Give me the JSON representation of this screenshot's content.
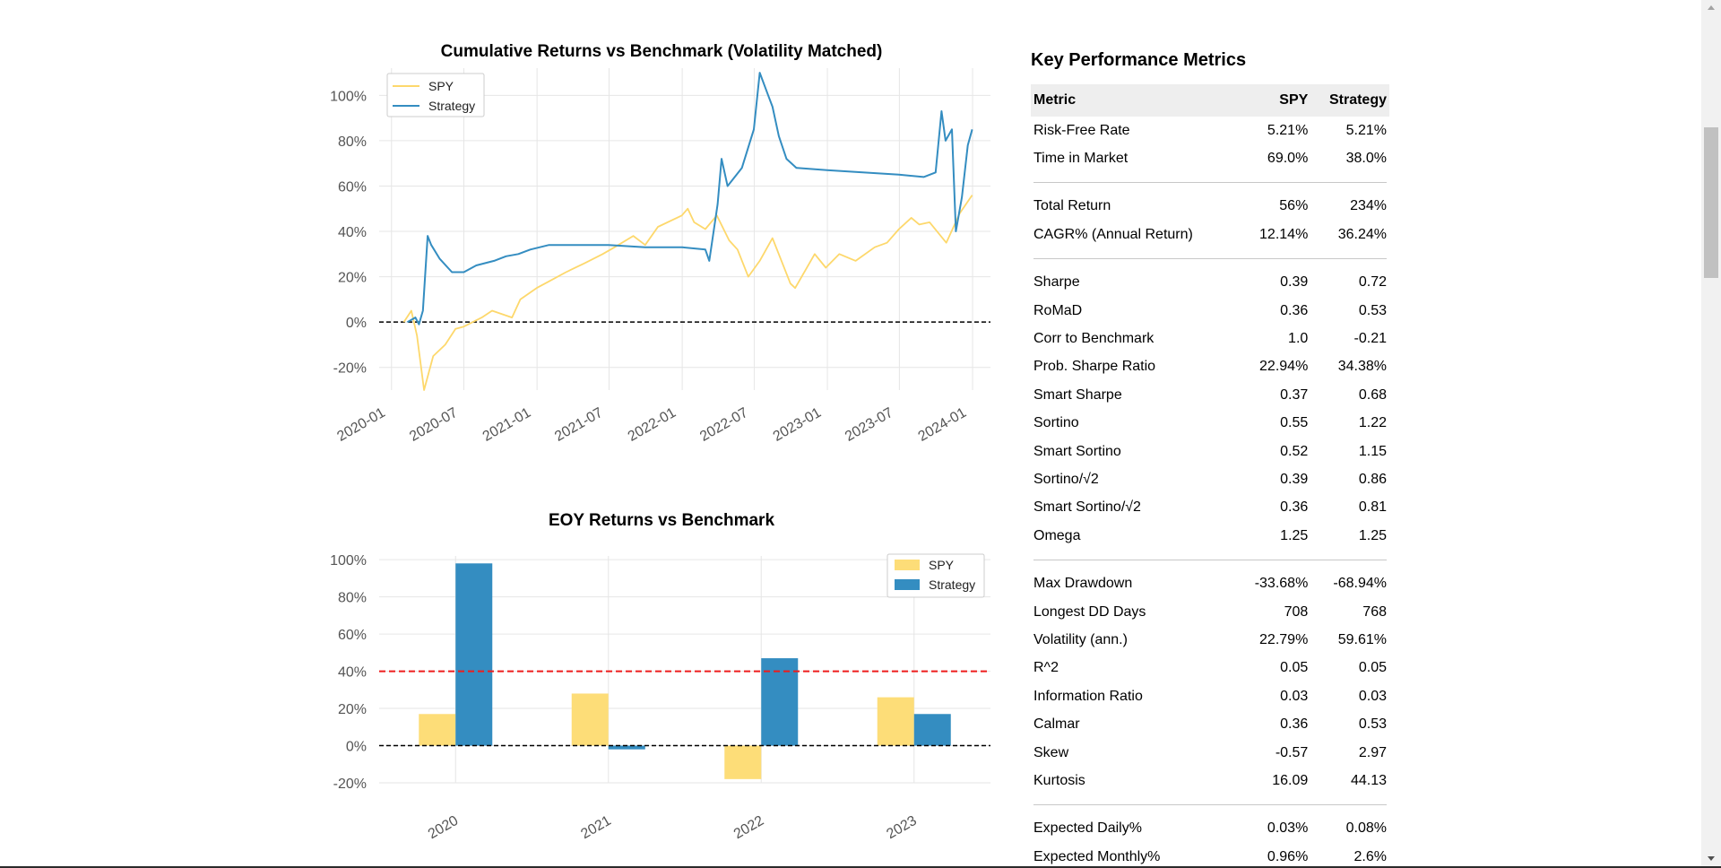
{
  "chart_data": [
    {
      "type": "line",
      "title": "Cumulative Returns vs Benchmark (Volatility Matched)",
      "x_ticks": [
        "2020-01",
        "2020-07",
        "2021-01",
        "2021-07",
        "2022-01",
        "2022-07",
        "2023-01",
        "2023-07",
        "2024-01"
      ],
      "y_ticks": [
        "-20%",
        "0%",
        "20%",
        "40%",
        "60%",
        "80%",
        "100%"
      ],
      "ylim": [
        -30,
        112
      ],
      "xlim": [
        "2019-12-01",
        "2024-02-15"
      ],
      "grid": true,
      "legend_position": "top-left",
      "baseline": 0,
      "series": [
        {
          "name": "SPY",
          "color": "#fdd86c",
          "points": [
            [
              "2020-02-01",
              0
            ],
            [
              "2020-02-20",
              5
            ],
            [
              "2020-03-05",
              -6
            ],
            [
              "2020-03-23",
              -30
            ],
            [
              "2020-04-15",
              -15
            ],
            [
              "2020-05-15",
              -10
            ],
            [
              "2020-06-10",
              -3
            ],
            [
              "2020-07-01",
              -2
            ],
            [
              "2020-08-15",
              2
            ],
            [
              "2020-09-10",
              5
            ],
            [
              "2020-10-30",
              2
            ],
            [
              "2020-11-20",
              10
            ],
            [
              "2020-12-31",
              15
            ],
            [
              "2021-02-01",
              18
            ],
            [
              "2021-03-15",
              22
            ],
            [
              "2021-05-01",
              26
            ],
            [
              "2021-06-15",
              30
            ],
            [
              "2021-07-15",
              33
            ],
            [
              "2021-08-31",
              38
            ],
            [
              "2021-09-30",
              34
            ],
            [
              "2021-11-01",
              42
            ],
            [
              "2021-12-31",
              47
            ],
            [
              "2022-01-15",
              50
            ],
            [
              "2022-01-31",
              44
            ],
            [
              "2022-02-28",
              41
            ],
            [
              "2022-03-29",
              47
            ],
            [
              "2022-04-29",
              36
            ],
            [
              "2022-05-20",
              32
            ],
            [
              "2022-06-16",
              20
            ],
            [
              "2022-07-15",
              27
            ],
            [
              "2022-08-16",
              37
            ],
            [
              "2022-09-30",
              17
            ],
            [
              "2022-10-12",
              15
            ],
            [
              "2022-11-30",
              30
            ],
            [
              "2022-12-28",
              24
            ],
            [
              "2023-01-31",
              30
            ],
            [
              "2023-03-13",
              27
            ],
            [
              "2023-04-30",
              33
            ],
            [
              "2023-05-31",
              35
            ],
            [
              "2023-06-30",
              41
            ],
            [
              "2023-07-31",
              46
            ],
            [
              "2023-08-20",
              43
            ],
            [
              "2023-09-15",
              44
            ],
            [
              "2023-10-27",
              35
            ],
            [
              "2023-11-30",
              48
            ],
            [
              "2023-12-31",
              56
            ]
          ]
        },
        {
          "name": "Strategy",
          "color": "#348dc1",
          "points": [
            [
              "2020-02-10",
              0
            ],
            [
              "2020-03-01",
              2
            ],
            [
              "2020-03-10",
              -1
            ],
            [
              "2020-03-20",
              5
            ],
            [
              "2020-04-01",
              38
            ],
            [
              "2020-04-10",
              34
            ],
            [
              "2020-05-01",
              28
            ],
            [
              "2020-06-01",
              22
            ],
            [
              "2020-07-01",
              22
            ],
            [
              "2020-08-01",
              25
            ],
            [
              "2020-09-15",
              27
            ],
            [
              "2020-10-15",
              29
            ],
            [
              "2020-11-15",
              30
            ],
            [
              "2020-12-15",
              32
            ],
            [
              "2021-01-31",
              34
            ],
            [
              "2021-06-30",
              34
            ],
            [
              "2021-09-30",
              33
            ],
            [
              "2021-12-31",
              33
            ],
            [
              "2022-02-28",
              32
            ],
            [
              "2022-03-10",
              27
            ],
            [
              "2022-03-31",
              52
            ],
            [
              "2022-04-10",
              72
            ],
            [
              "2022-04-25",
              60
            ],
            [
              "2022-05-31",
              68
            ],
            [
              "2022-06-30",
              85
            ],
            [
              "2022-07-15",
              110
            ],
            [
              "2022-08-05",
              100
            ],
            [
              "2022-08-16",
              95
            ],
            [
              "2022-09-01",
              82
            ],
            [
              "2022-09-20",
              72
            ],
            [
              "2022-10-15",
              68
            ],
            [
              "2022-12-31",
              67
            ],
            [
              "2023-03-31",
              66
            ],
            [
              "2023-06-30",
              65
            ],
            [
              "2023-08-31",
              64
            ],
            [
              "2023-09-30",
              66
            ],
            [
              "2023-10-15",
              93
            ],
            [
              "2023-10-25",
              80
            ],
            [
              "2023-11-10",
              85
            ],
            [
              "2023-11-20",
              40
            ],
            [
              "2023-12-05",
              55
            ],
            [
              "2023-12-20",
              78
            ],
            [
              "2023-12-31",
              85
            ]
          ]
        }
      ]
    },
    {
      "type": "bar",
      "title": "EOY Returns  vs Benchmark",
      "categories": [
        "2020",
        "2021",
        "2022",
        "2023"
      ],
      "y_ticks": [
        "-20%",
        "0%",
        "20%",
        "40%",
        "60%",
        "80%",
        "100%"
      ],
      "ylim": [
        -20,
        102
      ],
      "grid": true,
      "legend_position": "top-right",
      "reference_line": {
        "value": 40,
        "color": "#ee1c1c",
        "style": "dashed"
      },
      "baseline": 0,
      "series": [
        {
          "name": "SPY",
          "color": "#fddd78",
          "values": [
            17,
            28,
            -18,
            26
          ]
        },
        {
          "name": "Strategy",
          "color": "#348dc1",
          "values": [
            98,
            -2,
            47,
            17
          ]
        }
      ]
    }
  ],
  "metrics": {
    "title": "Key Performance Metrics",
    "columns": [
      "Metric",
      "SPY",
      "Strategy"
    ],
    "groups": [
      [
        [
          "Risk-Free Rate",
          "5.21%",
          "5.21%"
        ],
        [
          "Time in Market",
          "69.0%",
          "38.0%"
        ]
      ],
      [
        [
          "Total Return",
          "56%",
          "234%"
        ],
        [
          "CAGR% (Annual Return)",
          "12.14%",
          "36.24%"
        ]
      ],
      [
        [
          "Sharpe",
          "0.39",
          "0.72"
        ],
        [
          "RoMaD",
          "0.36",
          "0.53"
        ],
        [
          "Corr to Benchmark",
          "1.0",
          "-0.21"
        ],
        [
          "Prob. Sharpe Ratio",
          "22.94%",
          "34.38%"
        ],
        [
          "Smart Sharpe",
          "0.37",
          "0.68"
        ],
        [
          "Sortino",
          "0.55",
          "1.22"
        ],
        [
          "Smart Sortino",
          "0.52",
          "1.15"
        ],
        [
          "Sortino/√2",
          "0.39",
          "0.86"
        ],
        [
          "Smart Sortino/√2",
          "0.36",
          "0.81"
        ],
        [
          "Omega",
          "1.25",
          "1.25"
        ]
      ],
      [
        [
          "Max Drawdown",
          "-33.68%",
          "-68.94%"
        ],
        [
          "Longest DD Days",
          "708",
          "768"
        ],
        [
          "Volatility (ann.)",
          "22.79%",
          "59.61%"
        ],
        [
          "R^2",
          "0.05",
          "0.05"
        ],
        [
          "Information Ratio",
          "0.03",
          "0.03"
        ],
        [
          "Calmar",
          "0.36",
          "0.53"
        ],
        [
          "Skew",
          "-0.57",
          "2.97"
        ],
        [
          "Kurtosis",
          "16.09",
          "44.13"
        ]
      ],
      [
        [
          "Expected Daily%",
          "0.03%",
          "0.08%"
        ],
        [
          "Expected Monthly%",
          "0.96%",
          "2.6%"
        ]
      ]
    ]
  }
}
